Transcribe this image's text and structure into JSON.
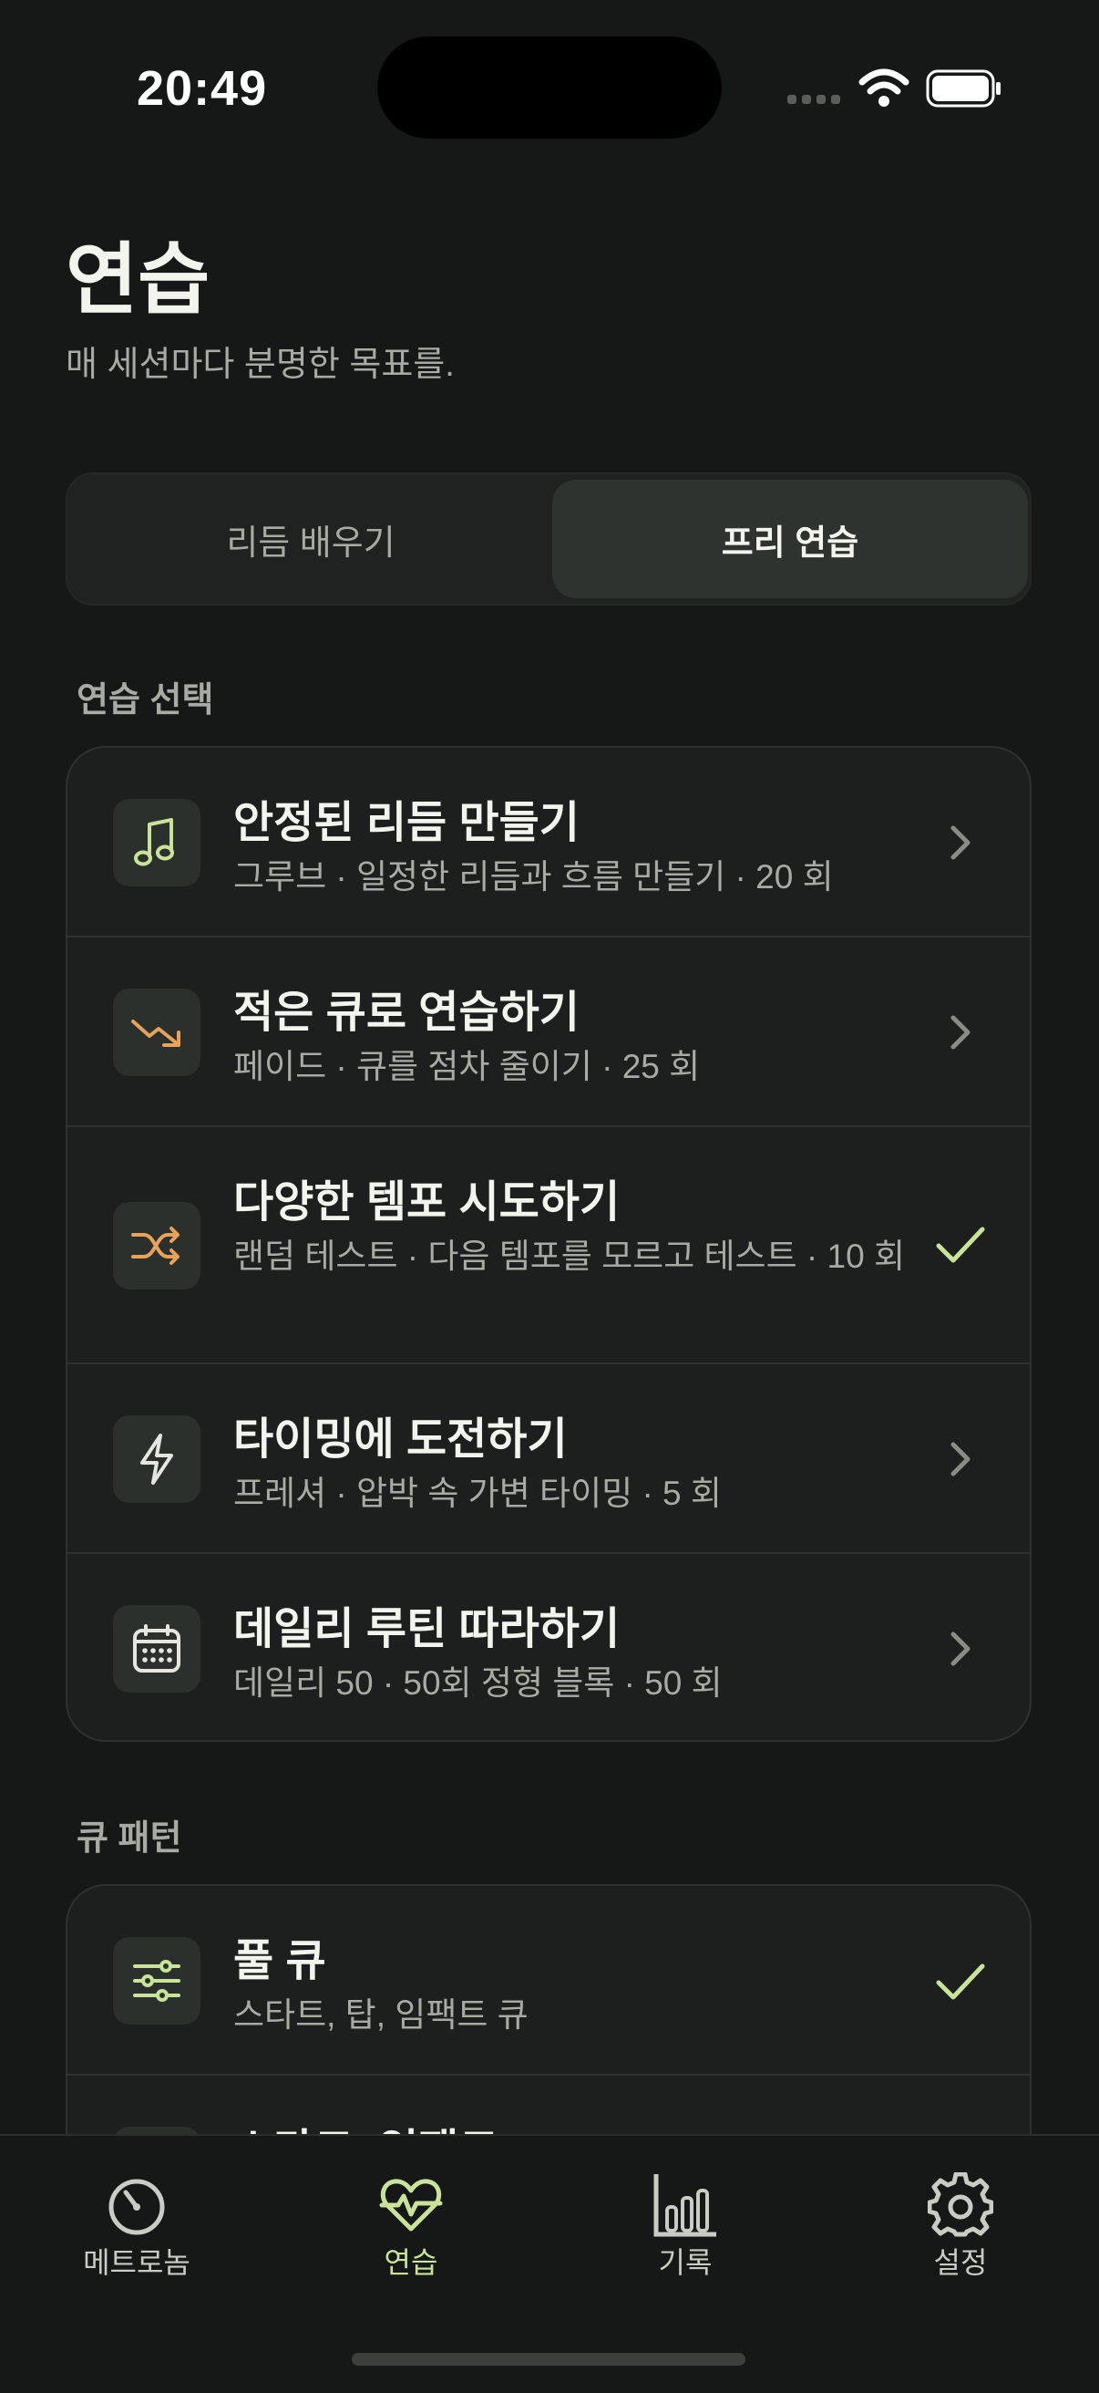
{
  "status": {
    "time": "20:49"
  },
  "header": {
    "title": "연습",
    "subtitle": "매 세션마다 분명한 목표를."
  },
  "segments": {
    "left": "리듬 배우기",
    "right": "프리 연습",
    "selected": "프리 연습"
  },
  "practice_section": {
    "label": "연습 선택",
    "items": [
      {
        "title": "안정된 리듬 만들기",
        "subtitle": "그루브 · 일정한 리듬과 흐름 만들기 · 20 회",
        "icon": "music-note-icon",
        "trailing": "chevron"
      },
      {
        "title": "적은 큐로 연습하기",
        "subtitle": "페이드 · 큐를 점차 줄이기 · 25 회",
        "icon": "trend-down-icon",
        "trailing": "chevron"
      },
      {
        "title": "다양한 템포 시도하기",
        "subtitle": "랜덤 테스트 · 다음 템포를 모르고 테스트 · 10 회",
        "icon": "shuffle-icon",
        "trailing": "check"
      },
      {
        "title": "타이밍에 도전하기",
        "subtitle": "프레셔 · 압박 속 가변 타이밍 · 5 회",
        "icon": "bolt-icon",
        "trailing": "chevron"
      },
      {
        "title": "데일리 루틴 따라하기",
        "subtitle": "데일리 50 · 50회 정형 블록 · 50 회",
        "icon": "calendar-icon",
        "trailing": "chevron"
      }
    ]
  },
  "cue_section": {
    "label": "큐 패턴",
    "items": [
      {
        "title": "풀 큐",
        "subtitle": "스타트, 탑, 임팩트 큐",
        "icon": "sliders-icon",
        "trailing": "check"
      },
      {
        "title": "스타트, 임팩트",
        "subtitle": "",
        "icon": "",
        "trailing": ""
      }
    ]
  },
  "tabbar": {
    "items": [
      {
        "label": "메트로놈",
        "icon": "metronome-icon"
      },
      {
        "label": "연습",
        "icon": "heart-pulse-icon",
        "active": true
      },
      {
        "label": "기록",
        "icon": "bar-chart-icon"
      },
      {
        "label": "설정",
        "icon": "gear-icon"
      }
    ]
  },
  "colors": {
    "background": "#161817",
    "accent_green": "#c9e39a",
    "accent_orange": "#e8a25a",
    "card": "#1c1f1d"
  }
}
